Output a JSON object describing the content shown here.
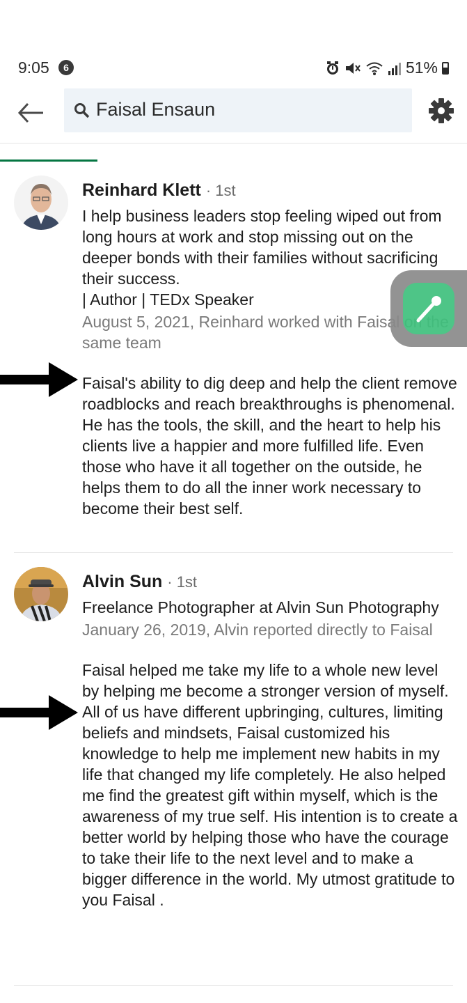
{
  "status_bar": {
    "time": "9:05",
    "notification_count": "6",
    "battery": "51%"
  },
  "search": {
    "query": "Faisal Ensaun"
  },
  "recommendations": [
    {
      "name": "Reinhard Klett",
      "degree": "· 1st",
      "headline": "I help business leaders stop feeling wiped out from long hours at work and stop missing out on the deeper bonds with their families without sacrificing their success.\n| Author | TEDx Speaker",
      "meta": "August 5, 2021, Reinhard worked with Faisal on the same team",
      "text": "Faisal's ability to dig deep and help the client remove roadblocks and reach breakthroughs is phenomenal.  He has the tools, the skill, and the heart to help his clients live a happier and more fulfilled life.   Even those who have it all together on the outside, he helps them to do all the inner work necessary to become their best self."
    },
    {
      "name": "Alvin Sun",
      "degree": "· 1st",
      "headline": "Freelance Photographer at Alvin Sun Photography",
      "meta": "January 26, 2019, Alvin reported directly to Faisal",
      "text": "Faisal helped me take my life to a whole new level by helping me become a stronger version of myself. All of us have different upbringing, cultures, limiting beliefs and mindsets, Faisal customized his knowledge to help me implement new habits in my life that changed my life completely. He also helped me find the greatest gift within myself, which is the awareness of my true self. His intention is to create a better world by helping those who have the courage to take their life to the next level and to make a bigger difference in the world. My utmost gratitude to you Faisal ."
    }
  ],
  "colors": {
    "accent": "#057642",
    "bubble": "#3fc17d",
    "search_bg": "#eef3f8"
  },
  "icons": [
    "back-arrow-icon",
    "search-icon",
    "gear-icon",
    "alarm-icon",
    "mute-icon",
    "wifi-icon",
    "signal-icon",
    "battery-icon",
    "pointer-arrow-icon",
    "eyedropper-icon"
  ]
}
